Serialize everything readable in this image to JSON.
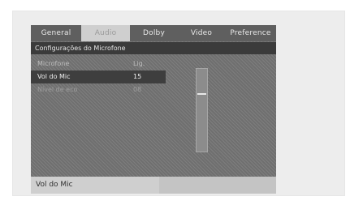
{
  "tabs": [
    {
      "label": "General"
    },
    {
      "label": "Audio"
    },
    {
      "label": "Dolby"
    },
    {
      "label": "Video"
    },
    {
      "label": "Preference"
    }
  ],
  "section": {
    "title": "Configurações do Microfone"
  },
  "settings": [
    {
      "label": "Microfone",
      "value": "Lig."
    },
    {
      "label": "Vol do Mic",
      "value": "15"
    },
    {
      "label": "Nível de eco",
      "value": "08"
    }
  ],
  "slider": {
    "value": 15,
    "max": 16
  },
  "status": {
    "text": "Vol do Mic"
  },
  "colors": {
    "accent": "#3e3e3e",
    "tab_active": "#cfcfcf"
  }
}
